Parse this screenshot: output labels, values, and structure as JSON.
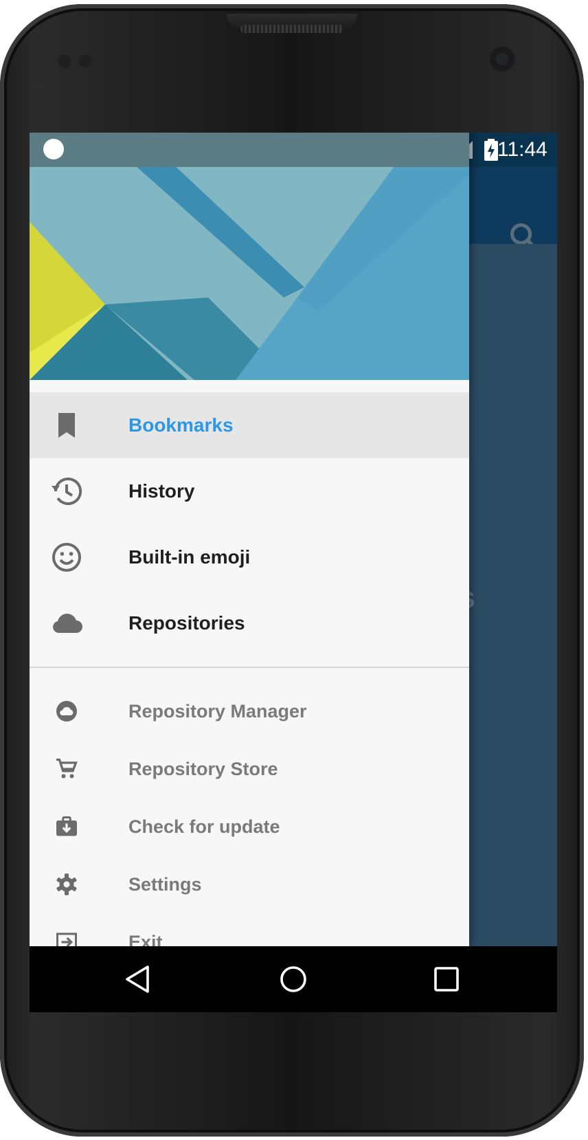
{
  "status_bar": {
    "time": "11:44"
  },
  "background_app": {
    "partial_text": "ks",
    "fab_icon": "plus-icon",
    "search_icon": "search-icon"
  },
  "drawer": {
    "primary_items": [
      {
        "label": "Bookmarks",
        "icon": "bookmark-icon",
        "selected": true
      },
      {
        "label": "History",
        "icon": "history-icon",
        "selected": false
      },
      {
        "label": "Built-in emoji",
        "icon": "smiley-icon",
        "selected": false
      },
      {
        "label": "Repositories",
        "icon": "cloud-icon",
        "selected": false
      }
    ],
    "secondary_items": [
      {
        "label": "Repository Manager",
        "icon": "cloud-circle-icon"
      },
      {
        "label": "Repository Store",
        "icon": "cart-icon"
      },
      {
        "label": "Check for update",
        "icon": "update-icon"
      },
      {
        "label": "Settings",
        "icon": "gear-icon"
      },
      {
        "label": "Exit",
        "icon": "exit-icon"
      }
    ]
  },
  "colors": {
    "accent": "#2c97e6",
    "app_bar": "#0e3a5e",
    "fab": "#7a1a3b",
    "drawer_bg": "#f7f7f7"
  }
}
